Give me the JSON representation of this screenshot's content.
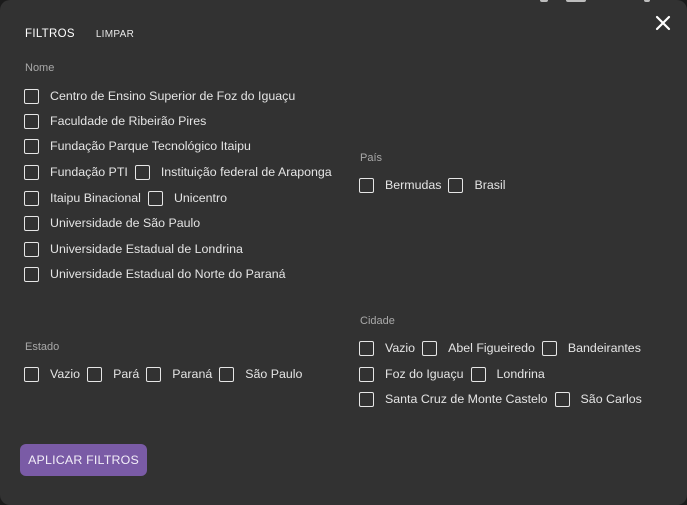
{
  "tabs": {
    "filters": "FILTROS",
    "clear": "LIMPAR"
  },
  "close_icon": "close-icon",
  "nome": {
    "label": "Nome",
    "options": [
      "Centro de Ensino Superior de Foz do Iguaçu",
      "Faculdade de Ribeirão Pires",
      "Fundação Parque Tecnológico Itaipu",
      "Fundação PTI",
      "Instituição federal de Araponga",
      "Itaipu Binacional",
      "Unicentro",
      "Universidade de São Paulo",
      "Universidade Estadual de Londrina",
      "Universidade Estadual do Norte do Paraná"
    ]
  },
  "pais": {
    "label": "País",
    "options": [
      "Bermudas",
      "Brasil"
    ]
  },
  "estado": {
    "label": "Estado",
    "options": [
      "Vazio",
      "Pará",
      "Paraná",
      "São Paulo"
    ]
  },
  "cidade": {
    "label": "Cidade",
    "options": [
      "Vazio",
      "Abel Figueiredo",
      "Bandeirantes",
      "Foz do Iguaçu",
      "Londrina",
      "Santa Cruz de Monte Castelo",
      "São Carlos"
    ]
  },
  "apply_button": "APLICAR FILTROS",
  "colors": {
    "dialog_bg": "#323232",
    "accent": "#7a5ba6",
    "text": "#e4e4e4",
    "muted": "#a9a9a9"
  }
}
